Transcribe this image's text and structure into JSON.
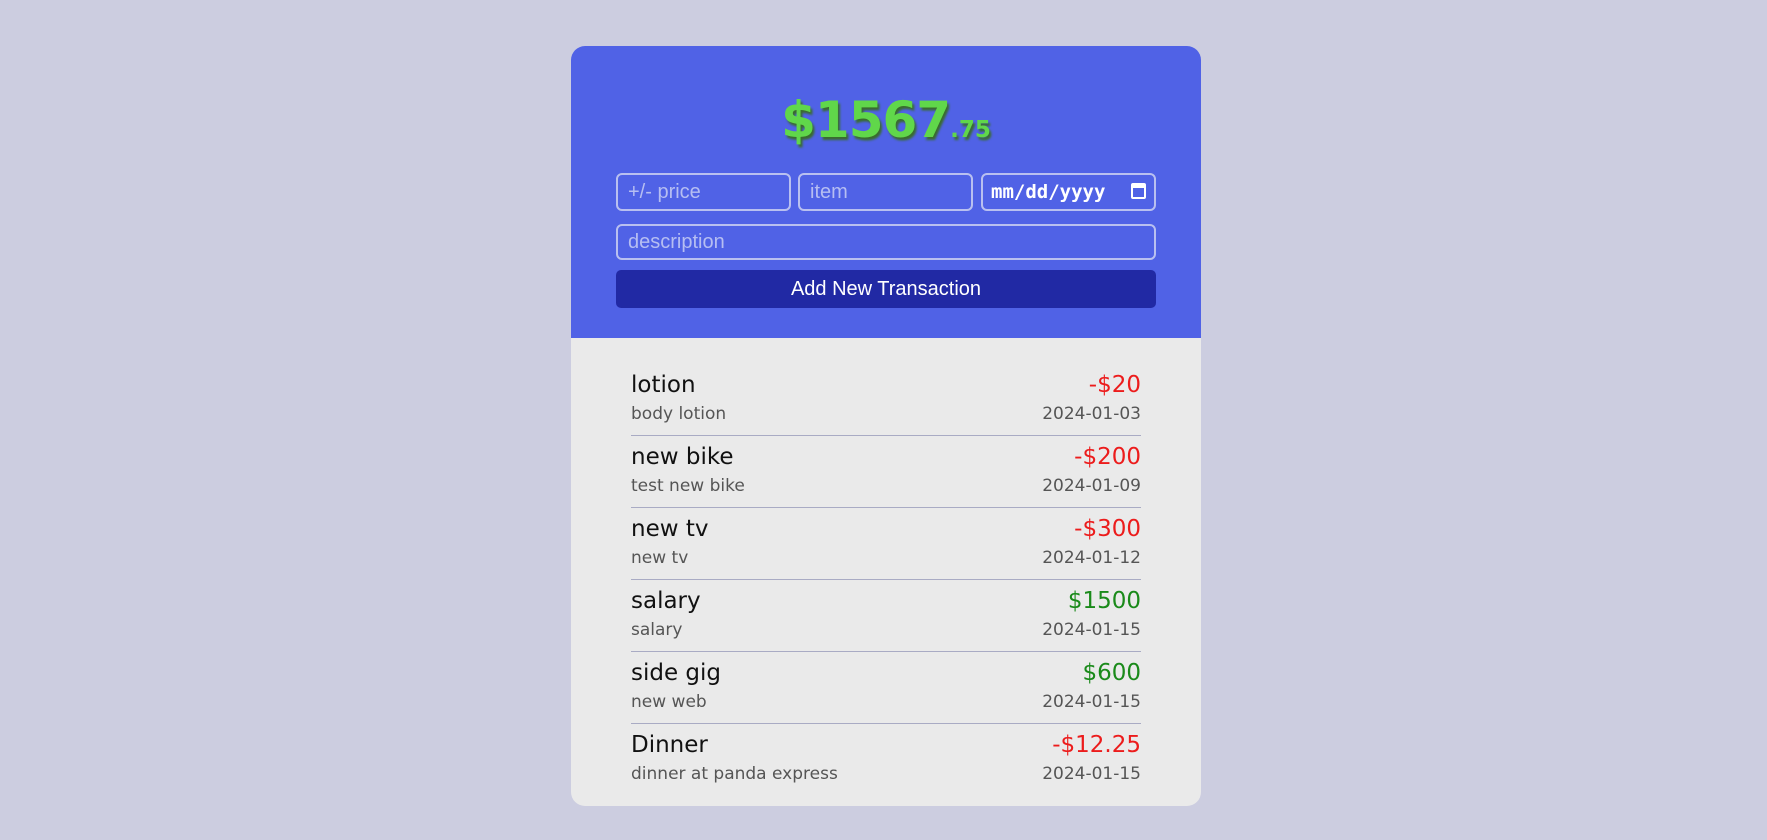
{
  "balance": {
    "dollars": "$1567",
    "cents": ".75"
  },
  "form": {
    "price_placeholder": "+/- price",
    "item_placeholder": "item",
    "date_placeholder": "mm/dd/yyyy",
    "description_placeholder": "description",
    "submit_label": "Add New Transaction"
  },
  "transactions": [
    {
      "name": "lotion",
      "description": "body lotion",
      "amount": "-$20",
      "date": "2024-01-03",
      "sign": "negative"
    },
    {
      "name": "new bike",
      "description": "test new bike",
      "amount": "-$200",
      "date": "2024-01-09",
      "sign": "negative"
    },
    {
      "name": "new tv",
      "description": "new tv",
      "amount": "-$300",
      "date": "2024-01-12",
      "sign": "negative"
    },
    {
      "name": "salary",
      "description": "salary",
      "amount": "$1500",
      "date": "2024-01-15",
      "sign": "positive"
    },
    {
      "name": "side gig",
      "description": "new web",
      "amount": "$600",
      "date": "2024-01-15",
      "sign": "positive"
    },
    {
      "name": "Dinner",
      "description": "dinner at panda express",
      "amount": "-$12.25",
      "date": "2024-01-15",
      "sign": "negative"
    }
  ],
  "colors": {
    "page_background": "#cccde0",
    "header_background": "#5062e6",
    "button_background": "#2129a4",
    "balance_text": "#60d74a",
    "negative_amount": "#ec1c1c",
    "positive_amount": "#1a8a1a"
  },
  "icons": {
    "date_picker": "calendar-icon"
  }
}
